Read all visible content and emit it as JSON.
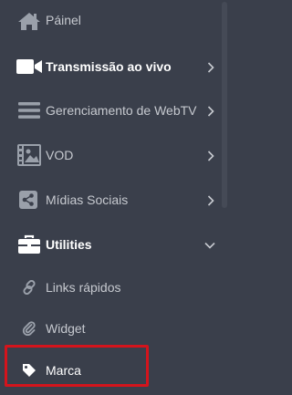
{
  "menu": {
    "items": [
      {
        "label": "Páinel",
        "icon": "home-icon"
      },
      {
        "label": "Transmissão ao vivo",
        "icon": "video-camera-icon"
      },
      {
        "label": "Gerenciamento de WebTV",
        "icon": "list-icon"
      },
      {
        "label": "VOD",
        "icon": "film-icon"
      },
      {
        "label": "Mídias Sociais",
        "icon": "share-icon"
      },
      {
        "label": "Utilities",
        "icon": "briefcase-icon"
      },
      {
        "label": "Links rápidos",
        "icon": "link-icon"
      },
      {
        "label": "Widget",
        "icon": "paperclip-icon"
      },
      {
        "label": "Marca",
        "icon": "tag-icon"
      }
    ]
  },
  "colors": {
    "background": "#3a3f4b",
    "text": "#c6c9cf",
    "text_active": "#ffffff",
    "icon": "#9aa0aa",
    "highlight": "#d4141c"
  }
}
